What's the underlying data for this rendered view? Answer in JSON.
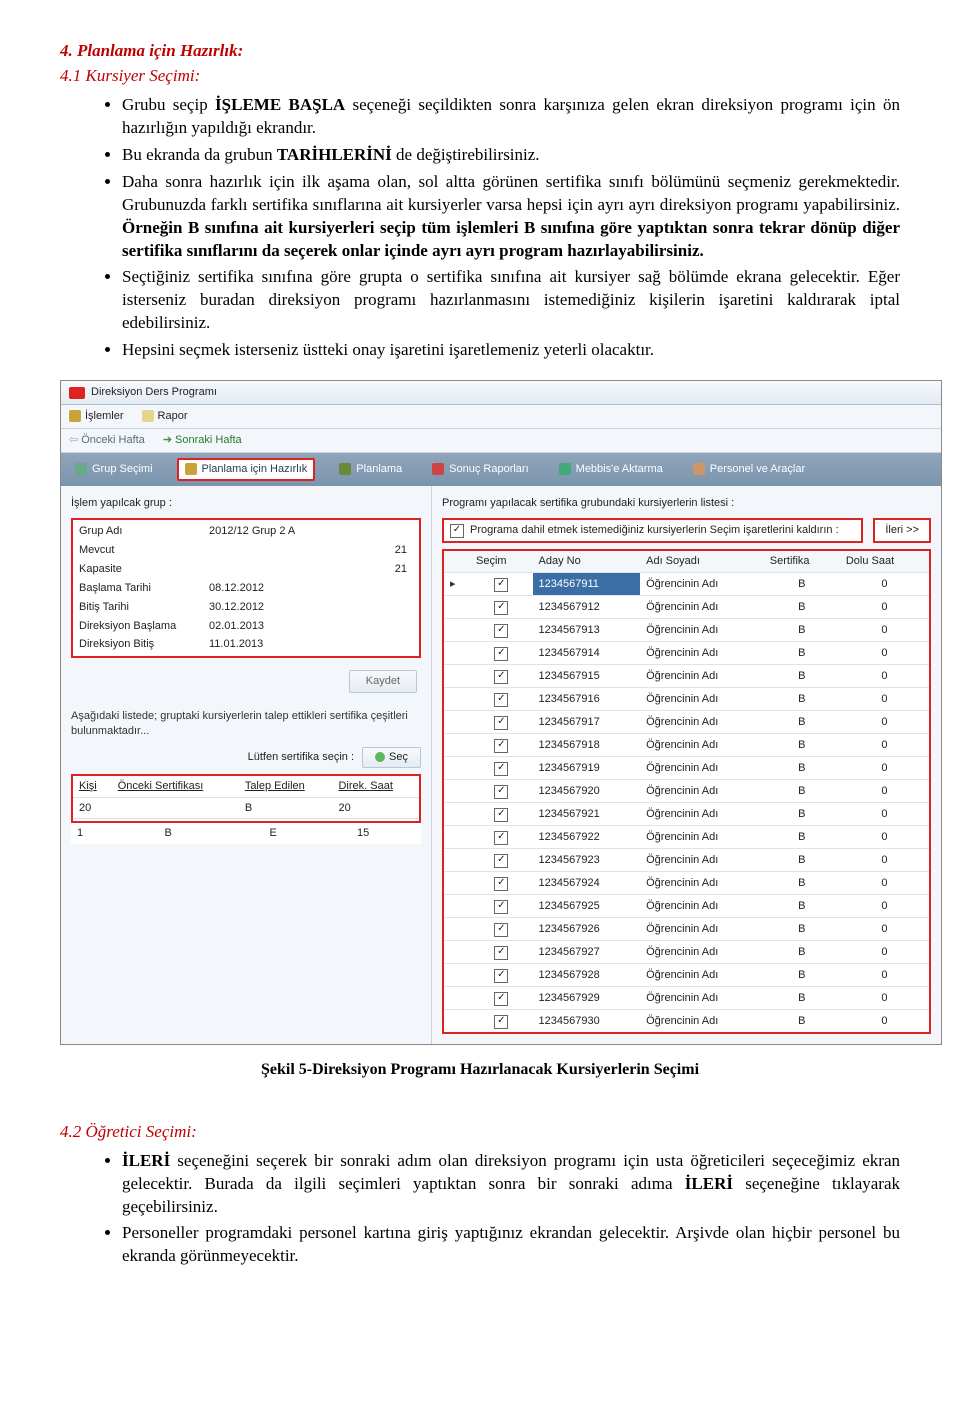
{
  "doc": {
    "h4": "4.  Planlama için Hazırlık:",
    "h41": "4.1 Kursiyer Seçimi:",
    "bullets1": [
      "Grubu seçip İŞLEME BAŞLA seçeneği seçildikten sonra karşınıza gelen ekran direksiyon programı için ön hazırlığın yapıldığı ekrandır.",
      "Bu ekranda da grubun TARİHLERİNİ de değiştirebilirsiniz.",
      "Daha sonra hazırlık için ilk aşama olan, sol altta görünen sertifika sınıfı bölümünü seçmeniz gerekmektedir. Grubunuzda farklı sertifika sınıflarına ait kursiyerler varsa hepsi için ayrı ayrı direksiyon programı yapabilirsiniz. Örneğin B sınıfına ait kursiyerleri seçip tüm işlemleri B sınıfına göre yaptıktan sonra tekrar dönüp diğer sertifika sınıflarını da seçerek onlar içinde ayrı ayrı program hazırlayabilirsiniz.",
      "Seçtiğiniz sertifika sınıfına göre grupta o sertifika sınıfına ait kursiyer sağ bölümde ekrana gelecektir. Eğer isterseniz buradan direksiyon programı hazırlanmasını istemediğiniz kişilerin işaretini kaldırarak iptal edebilirsiniz.",
      "Hepsini seçmek isterseniz üstteki onay işaretini işaretlemeniz yeterli olacaktır."
    ],
    "caption": "Şekil 5-Direksiyon Programı Hazırlanacak Kursiyerlerin Seçimi",
    "h42": "4.2 Öğretici Seçimi:",
    "bullets2": [
      "İLERİ seçeneğini seçerek bir sonraki adım olan direksiyon programı için usta öğreticileri seçeceğimiz ekran gelecektir. Burada da ilgili seçimleri yaptıktan sonra bir sonraki adıma İLERİ seçeneğine tıklayarak geçebilirsiniz.",
      "Personeller programdaki personel kartına giriş yaptığınız ekrandan gelecektir. Arşivde olan hiçbir personel bu ekranda görünmeyecektir."
    ]
  },
  "ui": {
    "title": "Direksiyon Ders Programı",
    "menu": {
      "islemler": "İşlemler",
      "rapor": "Rapor"
    },
    "nav": {
      "prev": "Önceki Hafta",
      "next": "Sonraki Hafta"
    },
    "tabs": {
      "grup": "Grup Seçimi",
      "hazirlik": "Planlama için Hazırlık",
      "planlama": "Planlama",
      "sonuc": "Sonuç Raporları",
      "mebbis": "Mebbis'e Aktarma",
      "personel": "Personel ve Araçlar"
    },
    "left": {
      "label": "İşlem yapılcak grup :",
      "group": {
        "grup_adi_k": "Grup Adı",
        "grup_adi_v": "2012/12 Grup 2 A",
        "mevcut_k": "Mevcut",
        "mevcut_v": "21",
        "kapasite_k": "Kapasite",
        "kapasite_v": "21",
        "baslama_k": "Başlama Tarihi",
        "baslama_v": "08.12.2012",
        "bitis_k": "Bitiş Tarihi",
        "bitis_v": "30.12.2012",
        "dir_bas_k": "Direksiyon Başlama",
        "dir_bas_v": "02.01.2013",
        "dir_bit_k": "Direksiyon Bitiş",
        "dir_bit_v": "11.01.2013"
      },
      "kaydet": "Kaydet",
      "hint": "Aşağıdaki listede; gruptaki kursiyerlerin talep ettikleri sertifika çeşitleri bulunmaktadır...",
      "cert_label": "Lütfen sertifika seçin :",
      "sec": "Seç",
      "mini": {
        "h1": "Kişi",
        "h2": "Önceki Sertifikası",
        "h3": "Talep Edilen",
        "h4": "Direk. Saat",
        "r1": [
          "20",
          "",
          "B",
          "20"
        ],
        "r2": [
          "1",
          "B",
          "E",
          "15"
        ]
      }
    },
    "right": {
      "label": "Programı yapılacak sertifika grubundaki kursiyerlerin listesi :",
      "filter": "Programa dahil etmek istemediğiniz kursiyerlerin Seçim işaretlerini kaldırın :",
      "ileri": "İleri >>",
      "headers": {
        "secim": "Seçim",
        "aday": "Aday No",
        "ad": "Adı Soyadı",
        "sert": "Sertifika",
        "saat": "Dolu Saat"
      },
      "rows": [
        {
          "no": "1234567911",
          "ad": "Öğrencinin Adı",
          "s": "B",
          "h": "0",
          "sel": true
        },
        {
          "no": "1234567912",
          "ad": "Öğrencinin Adı",
          "s": "B",
          "h": "0"
        },
        {
          "no": "1234567913",
          "ad": "Öğrencinin Adı",
          "s": "B",
          "h": "0"
        },
        {
          "no": "1234567914",
          "ad": "Öğrencinin Adı",
          "s": "B",
          "h": "0"
        },
        {
          "no": "1234567915",
          "ad": "Öğrencinin Adı",
          "s": "B",
          "h": "0"
        },
        {
          "no": "1234567916",
          "ad": "Öğrencinin Adı",
          "s": "B",
          "h": "0"
        },
        {
          "no": "1234567917",
          "ad": "Öğrencinin Adı",
          "s": "B",
          "h": "0"
        },
        {
          "no": "1234567918",
          "ad": "Öğrencinin Adı",
          "s": "B",
          "h": "0"
        },
        {
          "no": "1234567919",
          "ad": "Öğrencinin Adı",
          "s": "B",
          "h": "0"
        },
        {
          "no": "1234567920",
          "ad": "Öğrencinin Adı",
          "s": "B",
          "h": "0"
        },
        {
          "no": "1234567921",
          "ad": "Öğrencinin Adı",
          "s": "B",
          "h": "0"
        },
        {
          "no": "1234567922",
          "ad": "Öğrencinin Adı",
          "s": "B",
          "h": "0"
        },
        {
          "no": "1234567923",
          "ad": "Öğrencinin Adı",
          "s": "B",
          "h": "0"
        },
        {
          "no": "1234567924",
          "ad": "Öğrencinin Adı",
          "s": "B",
          "h": "0"
        },
        {
          "no": "1234567925",
          "ad": "Öğrencinin Adı",
          "s": "B",
          "h": "0"
        },
        {
          "no": "1234567926",
          "ad": "Öğrencinin Adı",
          "s": "B",
          "h": "0"
        },
        {
          "no": "1234567927",
          "ad": "Öğrencinin Adı",
          "s": "B",
          "h": "0"
        },
        {
          "no": "1234567928",
          "ad": "Öğrencinin Adı",
          "s": "B",
          "h": "0"
        },
        {
          "no": "1234567929",
          "ad": "Öğrencinin Adı",
          "s": "B",
          "h": "0"
        },
        {
          "no": "1234567930",
          "ad": "Öğrencinin Adı",
          "s": "B",
          "h": "0"
        }
      ]
    }
  }
}
